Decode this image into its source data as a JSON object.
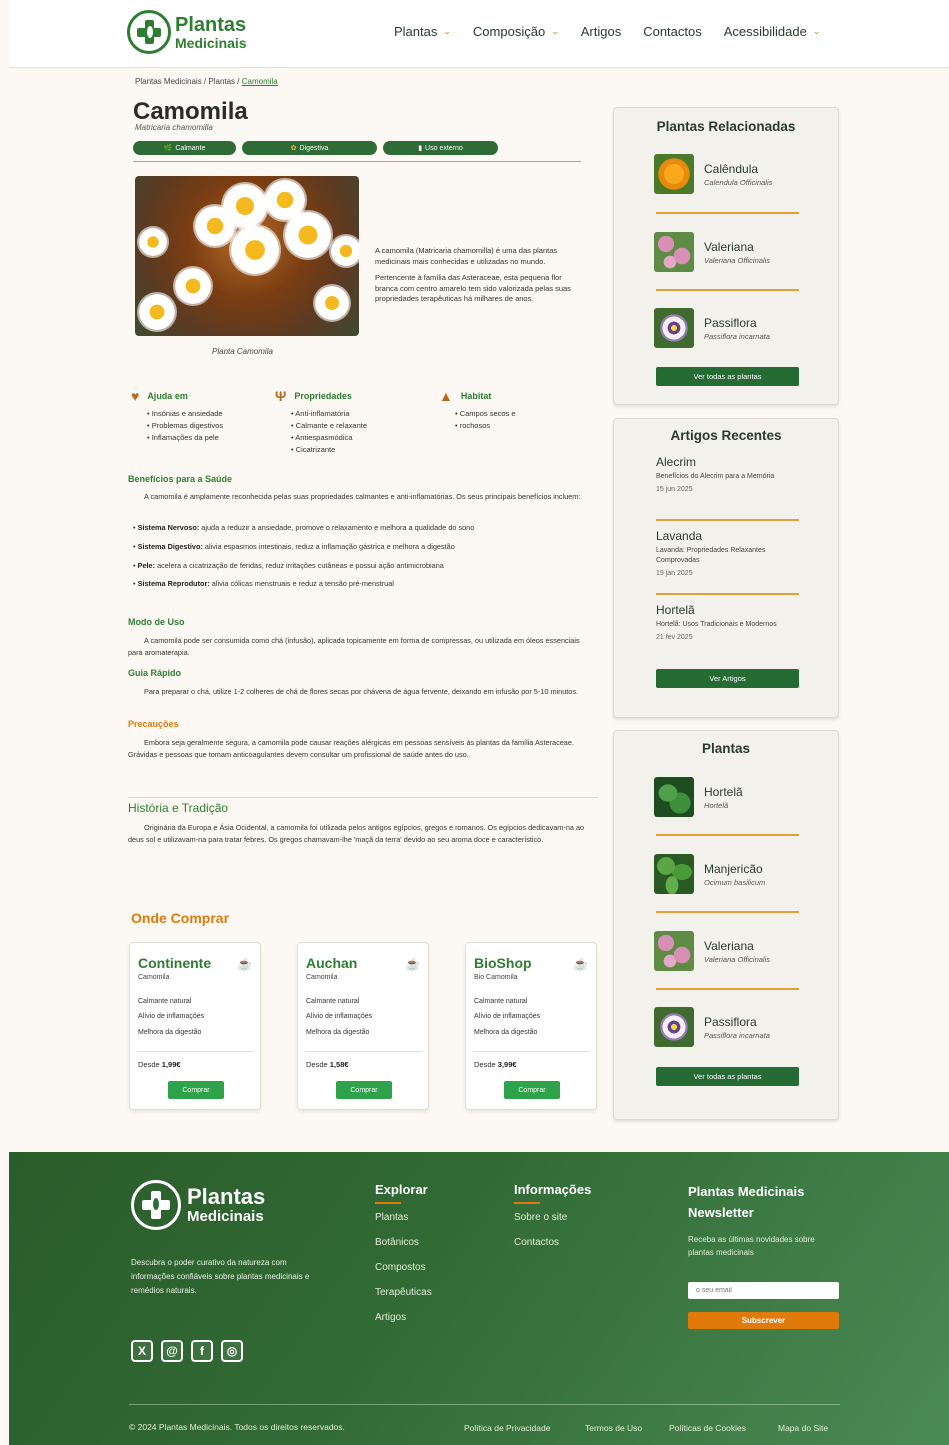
{
  "header": {
    "logo_line1": "Plantas",
    "logo_line2": "Medicinais",
    "nav": [
      {
        "label": "Plantas",
        "dropdown": true
      },
      {
        "label": "Composição",
        "dropdown": true
      },
      {
        "label": "Artigos",
        "dropdown": false
      },
      {
        "label": "Contactos",
        "dropdown": false
      },
      {
        "label": "Acessibilidade",
        "dropdown": true
      }
    ]
  },
  "breadcrumb": {
    "root": "Plantas Medicinais",
    "section": "Plantas",
    "current": "Camomila",
    "sep": " / "
  },
  "plant": {
    "name": "Camomila",
    "scientific": "Matricaria chamomilla",
    "tags": [
      {
        "label": "Calmante",
        "icon": "leaf-icon",
        "glyph": "🌿"
      },
      {
        "label": "Digestiva",
        "icon": "flower-icon",
        "glyph": "✿"
      },
      {
        "label": "Uso externo",
        "icon": "bottle-icon",
        "glyph": "▮"
      }
    ],
    "photo_caption": "Planta Camomila",
    "intro_p1": "A camomila (Matricaria chamomilla) é uma das plantas medicinais mais conhecidas e utilizadas no mundo.",
    "intro_p2": "Pertencente à família das Asteraceae, esta pequena flor branca com centro amarelo tem sido valorizada pelas suas propriedades terapêuticas há milhares de anos."
  },
  "features": {
    "help": {
      "title": "Ajuda em",
      "icon": "heart-icon",
      "items": [
        "Insónias e ansiedade",
        "Problemas digestivos",
        "Inflamações da pele"
      ]
    },
    "properties": {
      "title": "Propriedades",
      "icon": "sprout-icon",
      "items": [
        "Anti-inflamatória",
        "Calmante e relaxante",
        "Antiespasmódica",
        "Cicatrizante"
      ]
    },
    "habitat": {
      "title": "Habitat",
      "icon": "mountain-icon",
      "items": [
        "Campos secos e",
        "rochosos"
      ]
    }
  },
  "benefits": {
    "title": "Benefícios para a Saúde",
    "intro": "A camomila é amplamente reconhecida pelas suas propriedades calmantes e anti-inflamatórias. Os seus principais benefícios incluem:",
    "items": [
      {
        "label": "Sistema Nervoso:",
        "text": " ajuda a reduzir a ansiedade, promove o relaxamento e melhora a qualidade do sono"
      },
      {
        "label": "Sistema Digestivo:",
        "text": " alivia espasmos intestinais, reduz a inflamação gástrica e melhora a digestão"
      },
      {
        "label": "Pele:",
        "text": " acelera a cicatrização de feridas, reduz irritações cutâneas e possui ação antimicrobiana"
      },
      {
        "label": "Sistema Reprodutor:",
        "text": " alivia cólicas menstruais e reduz a tensão pré-menstrual"
      }
    ]
  },
  "usage": {
    "title": "Modo de Uso",
    "text": "A camomila pode ser consumida como chá (infusão), aplicada topicamente em forma de compressas, ou utilizada em óleos essenciais para aromaterapia.",
    "guide_title": "Guia Rápido",
    "guide_text": "Para preparar o chá, utilize 1-2 colheres de chá de flores secas por chávena de água fervente, deixando em infusão por 5-10 minutos.",
    "caution_title": "Precauções",
    "caution_text": "Embora seja geralmente segura, a camomila pode causar reações alérgicas em pessoas sensíveis às plantas da família Asteraceae. Grávidas e pessoas que tomam anticoagulantes devem consultar um profissional de saúde antes do uso."
  },
  "history": {
    "title": "História e Tradição",
    "text": "Originária da Europa e Ásia Ocidental, a camomila foi utilizada pelos antigos egípcios, gregos e romanos. Os egípcios dedicavam-na ao deus sol e utilizavam-na para tratar febres. Os gregos chamavam-lhe 'maçã da terra' devido ao seu aroma doce e característico."
  },
  "where_to_buy": {
    "title": "Onde Comprar",
    "stores": [
      {
        "name": "Continente",
        "product": "Camomila",
        "benefits": [
          "Calmante natural",
          "Alívio de inflamações",
          "Melhora da digestão"
        ],
        "price_prefix": "Desde ",
        "price": "1,99€",
        "button": "Comprar"
      },
      {
        "name": "Auchan",
        "product": "Camomila",
        "benefits": [
          "Calmante natural",
          "Alívio de inflamações",
          "Melhora da digestão"
        ],
        "price_prefix": "Desde ",
        "price": "1,58€",
        "button": "Comprar"
      },
      {
        "name": "BioShop",
        "product": "Bio Camomila",
        "benefits": [
          "Calmante natural",
          "Alívio de inflamações",
          "Melhora da digestão"
        ],
        "price_prefix": "Desde ",
        "price": "3,99€",
        "button": "Comprar"
      }
    ]
  },
  "sidebar": {
    "related": {
      "title": "Plantas Relacionadas",
      "items": [
        {
          "name": "Calêndula",
          "sci": "Calendula Officinalis"
        },
        {
          "name": "Valeriana",
          "sci": "Valeriana Officinalis"
        },
        {
          "name": "Passiflora",
          "sci": "Passiflora incarnata"
        }
      ],
      "button": "Ver todas as plantas"
    },
    "articles": {
      "title": "Artigos Recentes",
      "items": [
        {
          "name": "Alecrim",
          "desc": "Benefícios do Alecrim para a Memória",
          "date": "15 jun 2025"
        },
        {
          "name": "Lavanda",
          "desc": "Lavanda: Propriedades Relaxantes Comprovadas",
          "date": "19 jan 2025"
        },
        {
          "name": "Hortelã",
          "desc": "Hortelã: Usos Tradicionais e Modernos",
          "date": "21 fev 2025"
        }
      ],
      "button": "Ver Artigos"
    },
    "plants": {
      "title": "Plantas",
      "items": [
        {
          "name": "Hortelã",
          "sci": "Hortelã"
        },
        {
          "name": "Manjericão",
          "sci": "Ocimum basilicum"
        },
        {
          "name": "Valeriana",
          "sci": "Valeriana Officinalis"
        },
        {
          "name": "Passiflora",
          "sci": "Passiflora incarnata"
        }
      ],
      "button": "Ver todas as plantas"
    }
  },
  "footer": {
    "logo_line1": "Plantas",
    "logo_line2": "Medicinais",
    "description": "Descubra o poder curativo da natureza com informações confiáveis sobre plantas medicinais e remédios naturais.",
    "socials": [
      {
        "name": "x-icon",
        "glyph": "X"
      },
      {
        "name": "threads-icon",
        "glyph": "@"
      },
      {
        "name": "facebook-icon",
        "glyph": "f"
      },
      {
        "name": "instagram-icon",
        "glyph": "◎"
      }
    ],
    "explore": {
      "title": "Explorar",
      "links": [
        "Plantas",
        "Botânicos",
        "Compostos",
        "Terapêuticas",
        "Artigos"
      ]
    },
    "info": {
      "title": "Informações",
      "links": [
        "Sobre o site",
        "Contactos"
      ]
    },
    "newsletter": {
      "title": "Plantas Medicinais Newsletter",
      "desc": "Receba as últimas novidades sobre plantas medicinais",
      "placeholder": "o seu email",
      "button": "Subscrever"
    },
    "copyright": "© 2024 Plantas Medicinais. Todos os direitos reservados.",
    "legal": [
      "Política de Privacidade",
      "Termos de Uso",
      "Políticas de Cookies",
      "Mapa do Site"
    ]
  },
  "colors": {
    "primary_green": "#2e7d32",
    "dark_green": "#256b33",
    "accent_orange": "#e07a0b",
    "background": "#fcf9f4"
  }
}
